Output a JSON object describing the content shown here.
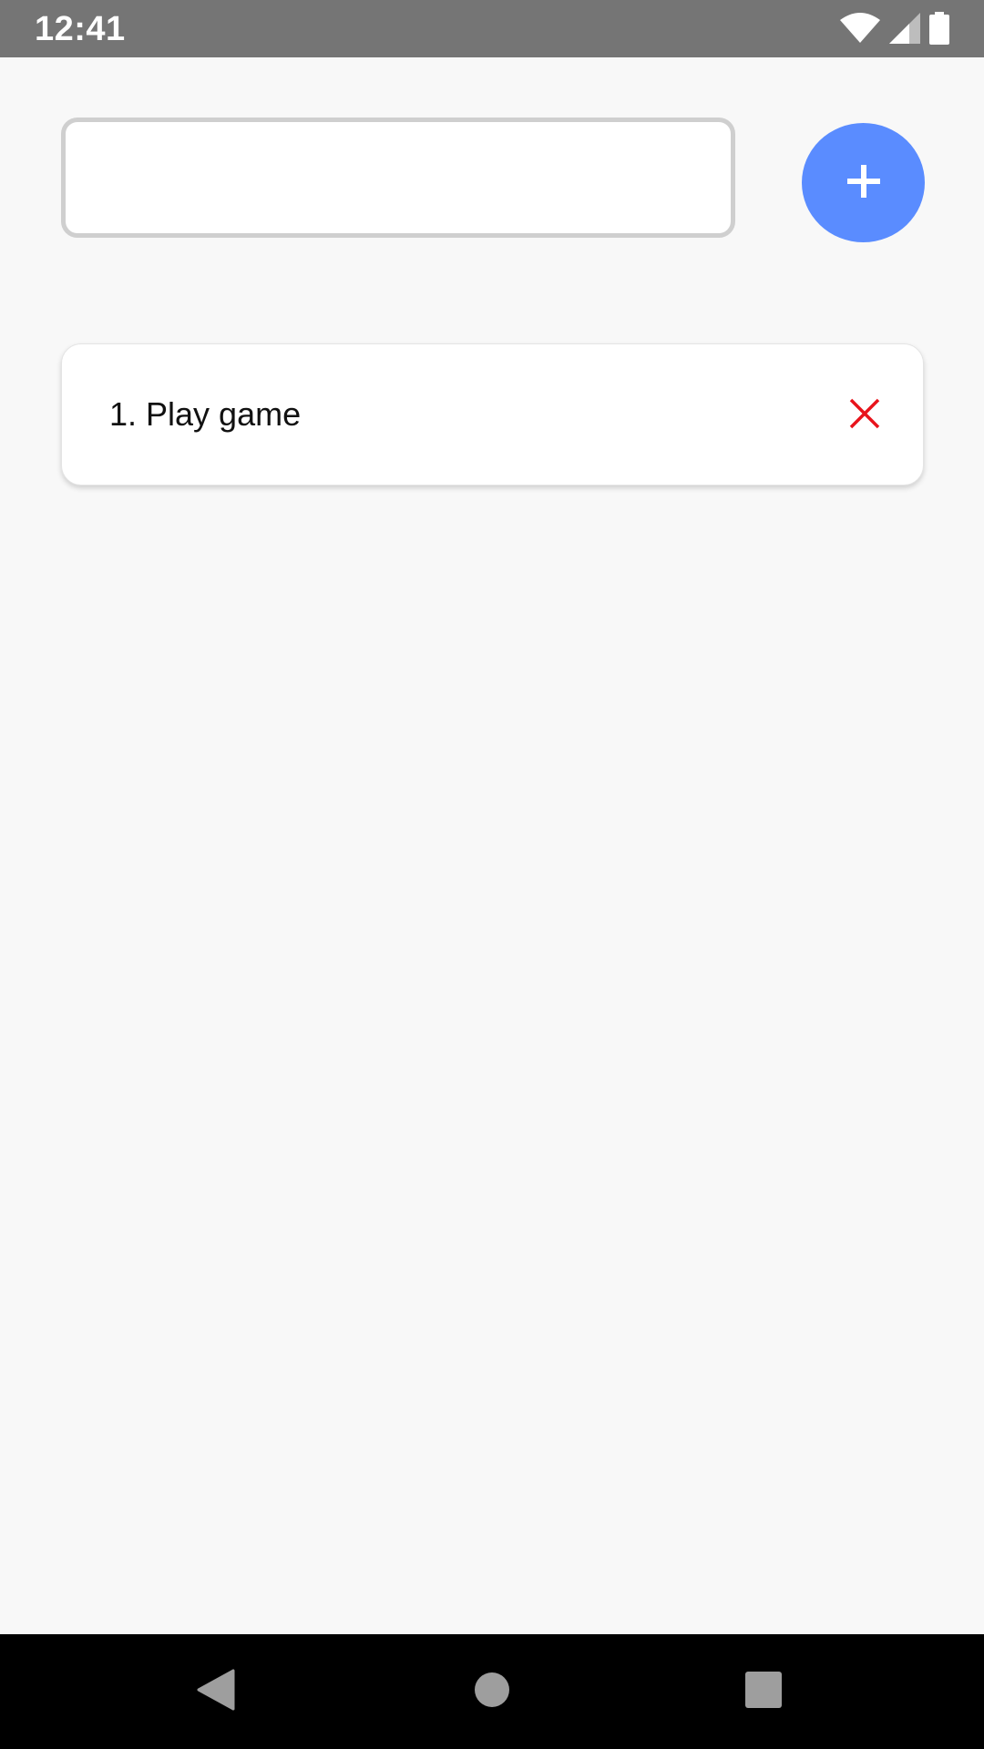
{
  "status_bar": {
    "time": "12:41",
    "icons": [
      "wifi-icon",
      "cellular-signal-icon",
      "battery-icon"
    ]
  },
  "task_input": {
    "value": "",
    "placeholder": ""
  },
  "add_button": {
    "icon": "plus-icon",
    "color": "#5a8cff"
  },
  "tasks": [
    {
      "label": "1. Play game",
      "delete_icon": "close-icon",
      "delete_color": "#e8141c"
    }
  ],
  "nav_bar": {
    "icons": [
      "back-icon",
      "home-icon",
      "recents-icon"
    ]
  },
  "colors": {
    "status_bar": "#757575",
    "background": "#f8f8f8",
    "nav_bar": "#000000"
  }
}
